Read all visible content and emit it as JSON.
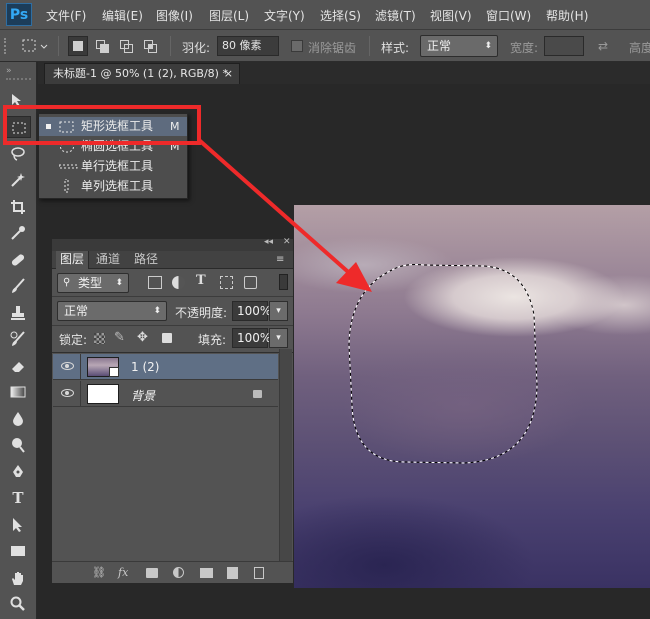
{
  "app": {
    "logo": "Ps"
  },
  "menu": [
    "文件(F)",
    "编辑(E)",
    "图像(I)",
    "图层(L)",
    "文字(Y)",
    "选择(S)",
    "滤镜(T)",
    "视图(V)",
    "窗口(W)",
    "帮助(H)"
  ],
  "options": {
    "feather_label": "羽化:",
    "feather_value": "80 像素",
    "antialias_label": "消除锯齿",
    "style_label": "样式:",
    "style_value": "正常",
    "width_label": "宽度:",
    "height_label": "高度"
  },
  "document_tab": {
    "title": "未标题-1 @ 50% (1 (2), RGB/8) *",
    "close": "×"
  },
  "flyout": {
    "items": [
      {
        "label": "矩形选框工具",
        "key": "M",
        "icon": "rect-marquee-icon",
        "active": true
      },
      {
        "label": "椭圆选框工具",
        "key": "M",
        "icon": "ellipse-marquee-icon"
      },
      {
        "label": "单行选框工具",
        "key": "",
        "icon": "single-row-marquee-icon"
      },
      {
        "label": "单列选框工具",
        "key": "",
        "icon": "single-column-marquee-icon"
      }
    ]
  },
  "layers_panel": {
    "tabs": [
      "图层",
      "通道",
      "路径"
    ],
    "filter_kind": "类型",
    "blend_mode": "正常",
    "opacity_label": "不透明度:",
    "opacity_value": "100%",
    "lock_label": "锁定:",
    "fill_label": "填充:",
    "fill_value": "100%",
    "layers": [
      {
        "name": "1 (2)",
        "selected": true
      },
      {
        "name": "背景",
        "locked": true
      }
    ],
    "bottom_fx": "fx"
  },
  "colors": {
    "highlight_red": "#ee2a2a",
    "selected_layer": "#5f6f85",
    "ps_blue": "#33a9f5"
  }
}
